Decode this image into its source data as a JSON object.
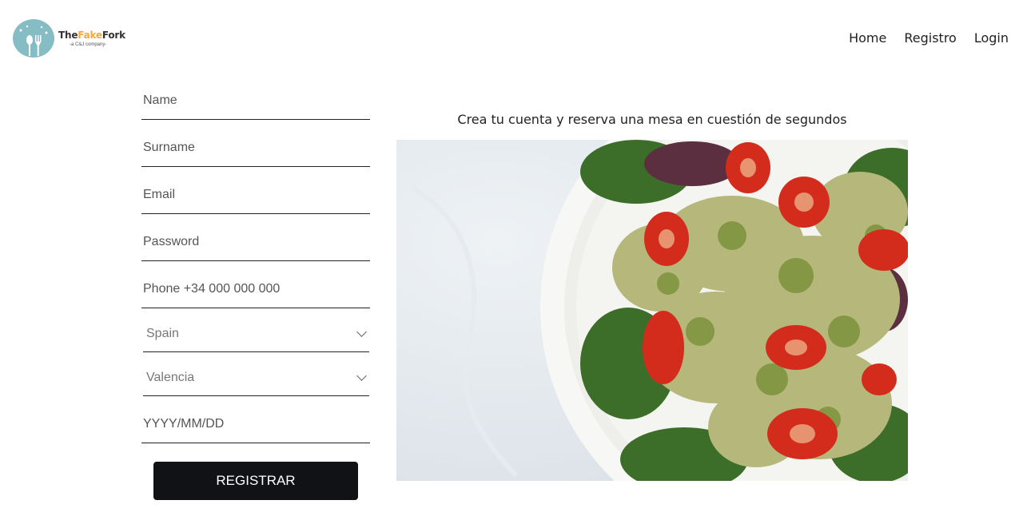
{
  "header": {
    "logo": {
      "brand_prefix": "The",
      "brand_accent": "Fake",
      "brand_suffix": "Fork",
      "tagline": "-a C&J company-"
    },
    "nav": [
      "Home",
      "Registro",
      "Login"
    ]
  },
  "form": {
    "name_placeholder": "Name",
    "surname_placeholder": "Surname",
    "email_placeholder": "Email",
    "password_placeholder": "Password",
    "phone_placeholder": "Phone +34 000 000 000",
    "country_selected": "Spain",
    "region_selected": "Valencia",
    "date_placeholder": "YYYY/MM/DD",
    "submit_label": "REGISTRAR"
  },
  "promo": {
    "text": "Crea tu cuenta y reserva una mesa en cuestión de segundos",
    "image_icon": "pasta-salad-photo"
  },
  "colors": {
    "background": "#ffffff",
    "button": "#101216",
    "logo_circle": "#86bcc4",
    "brand_accent": "#f4a93a"
  }
}
